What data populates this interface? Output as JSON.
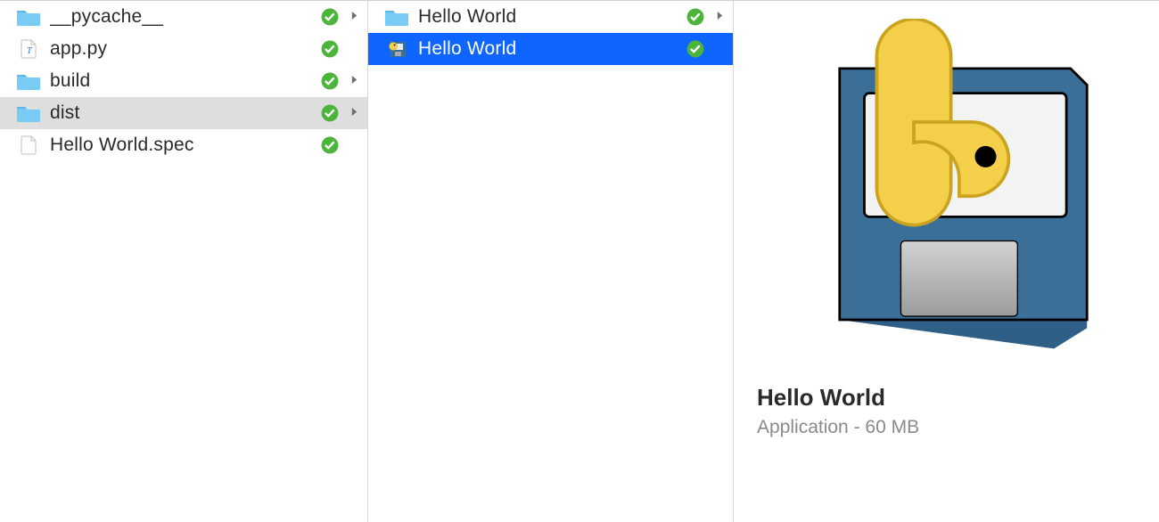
{
  "colors": {
    "folder": "#78cbf4",
    "folder_tab": "#5ab7e8",
    "selection_grey": "#dedede",
    "selection_blue": "#0e65ff",
    "status_green": "#4cb43a",
    "arrow_grey": "#6f6f6f",
    "disk_blue": "#3b6f97",
    "disk_label": "#ececec",
    "python_yellow": "#f4cf4a"
  },
  "column1": {
    "items": [
      {
        "name": "__pycache__",
        "icon": "folder-icon",
        "synced": true,
        "expandable": true,
        "selected": false
      },
      {
        "name": "app.py",
        "icon": "python-file-icon",
        "synced": true,
        "expandable": false,
        "selected": false
      },
      {
        "name": "build",
        "icon": "folder-icon",
        "synced": true,
        "expandable": true,
        "selected": false
      },
      {
        "name": "dist",
        "icon": "folder-icon",
        "synced": true,
        "expandable": true,
        "selected": true
      },
      {
        "name": "Hello World.spec",
        "icon": "blank-file-icon",
        "synced": true,
        "expandable": false,
        "selected": false
      }
    ]
  },
  "column2": {
    "items": [
      {
        "name": "Hello World",
        "icon": "folder-icon",
        "synced": true,
        "expandable": true,
        "selected": false
      },
      {
        "name": "Hello World",
        "icon": "app-icon",
        "synced": true,
        "expandable": false,
        "selected": true
      }
    ]
  },
  "preview": {
    "title": "Hello World",
    "kind": "Application",
    "size": "60 MB",
    "separator": " - "
  }
}
